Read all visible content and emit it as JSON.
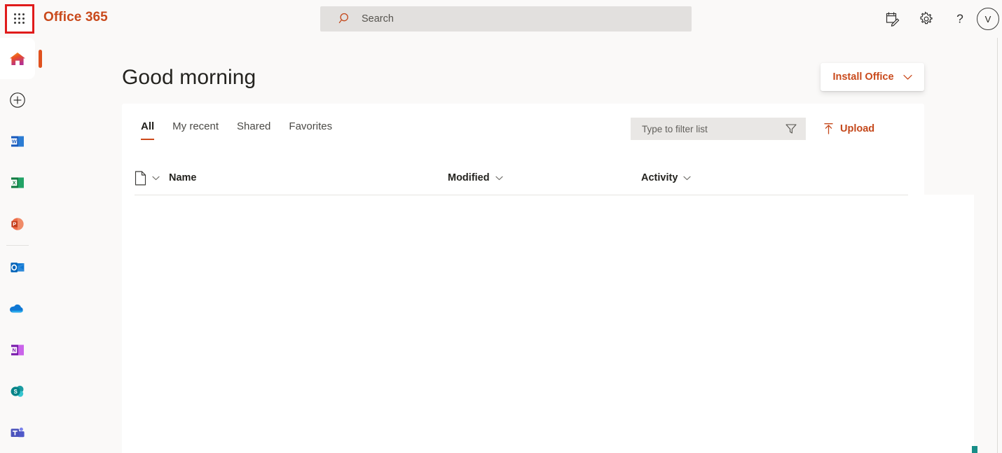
{
  "header": {
    "waffle_icon": "app-launcher-waffle-icon",
    "brand": "Office 365",
    "search": {
      "placeholder": "Search",
      "icon": "search-icon",
      "value": ""
    },
    "icons": [
      {
        "name": "note-pencil-icon",
        "glyph": "note"
      },
      {
        "name": "gear-icon",
        "glyph": "gear"
      },
      {
        "name": "help-icon",
        "glyph": "?"
      }
    ],
    "avatar": {
      "initial": "V",
      "name": "user-avatar"
    }
  },
  "sidebar": {
    "items": [
      {
        "label": "Home",
        "name": "sidebar-item-home",
        "icon": "home-icon",
        "selected": true
      },
      {
        "label": "Create",
        "name": "sidebar-item-create",
        "icon": "plus-circle-icon",
        "selected": false
      },
      {
        "label": "Word",
        "name": "sidebar-item-word",
        "icon": "word-icon",
        "selected": false
      },
      {
        "label": "Excel",
        "name": "sidebar-item-excel",
        "icon": "excel-icon",
        "selected": false
      },
      {
        "label": "PowerPoint",
        "name": "sidebar-item-powerpoint",
        "icon": "powerpoint-icon",
        "selected": false
      },
      {
        "label": "Outlook",
        "name": "sidebar-item-outlook",
        "icon": "outlook-icon",
        "selected": false
      },
      {
        "label": "OneDrive",
        "name": "sidebar-item-onedrive",
        "icon": "onedrive-icon",
        "selected": false
      },
      {
        "label": "OneNote",
        "name": "sidebar-item-onenote",
        "icon": "onenote-icon",
        "selected": false
      },
      {
        "label": "SharePoint",
        "name": "sidebar-item-sharepoint",
        "icon": "sharepoint-icon",
        "selected": false
      },
      {
        "label": "Teams",
        "name": "sidebar-item-teams",
        "icon": "teams-icon",
        "selected": false
      }
    ]
  },
  "main": {
    "greeting": "Good morning",
    "install_office": {
      "label": "Install Office",
      "chevron": "chevron-down-icon"
    },
    "tabs": [
      {
        "label": "All",
        "active": true
      },
      {
        "label": "My recent",
        "active": false
      },
      {
        "label": "Shared",
        "active": false
      },
      {
        "label": "Favorites",
        "active": false
      }
    ],
    "filter": {
      "placeholder": "Type to filter list",
      "value": "",
      "icon": "funnel-icon"
    },
    "upload": {
      "label": "Upload",
      "icon": "upload-arrow-icon"
    },
    "columns": {
      "type": "",
      "name": "Name",
      "modified": "Modified",
      "activity": "Activity"
    },
    "rows": []
  },
  "colors": {
    "brand_red": "#c94a1c",
    "accent_orange": "#e0521f",
    "highlight_border": "#e01b1b",
    "page_bg": "#faf9f8",
    "card_bg": "#ffffff"
  }
}
